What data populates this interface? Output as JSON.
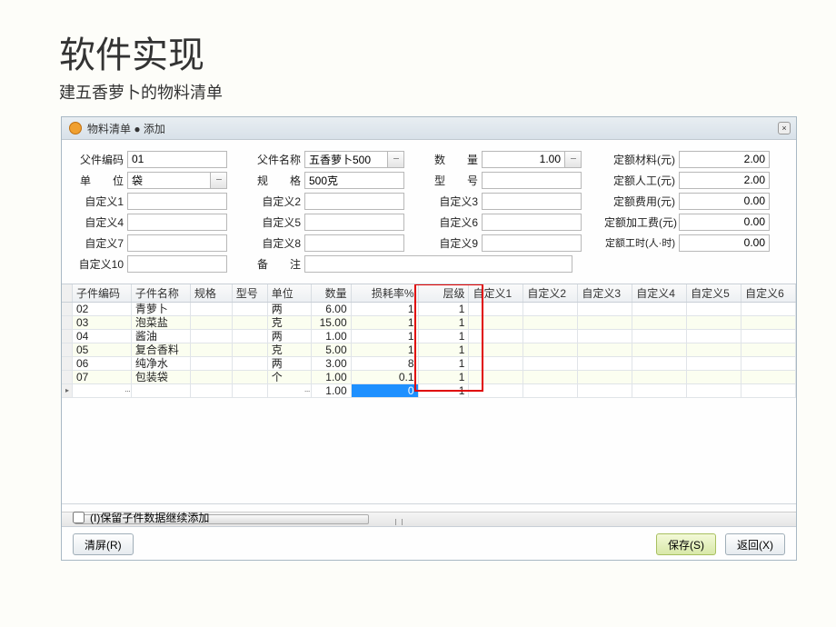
{
  "page": {
    "title": "软件实现",
    "subtitle": "建五香萝卜的物料清单"
  },
  "titlebar": {
    "text": "物料清单 ● 添加",
    "close": "×"
  },
  "form": {
    "parent_code_label": "父件编码",
    "parent_code": "01",
    "parent_name_label": "父件名称",
    "parent_name": "五香萝卜500",
    "qty_label": "数　　量",
    "qty": "1.00",
    "std_material_label": "定额材料(元)",
    "std_material": "2.00",
    "unit_label": "单　　位",
    "unit": "袋",
    "spec_label": "规　　格",
    "spec": "500克",
    "model_label": "型　　号",
    "model": "",
    "std_labor_label": "定额人工(元)",
    "std_labor": "2.00",
    "z1_label": "自定义1",
    "z1": "",
    "z2_label": "自定义2",
    "z2": "",
    "z3_label": "自定义3",
    "z3": "",
    "std_fee_label": "定额费用(元)",
    "std_fee": "0.00",
    "z4_label": "自定义4",
    "z4": "",
    "z5_label": "自定义5",
    "z5": "",
    "z6_label": "自定义6",
    "z6": "",
    "std_proc_label": "定额加工费(元)",
    "std_proc": "0.00",
    "z7_label": "自定义7",
    "z7": "",
    "z8_label": "自定义8",
    "z8": "",
    "z9_label": "自定义9",
    "z9": "",
    "std_time_label": "定额工时(人·时)",
    "std_time": "0.00",
    "z10_label": "自定义10",
    "z10": "",
    "remark_label": "备　　注",
    "remark": ""
  },
  "grid": {
    "headers": {
      "code": "子件编码",
      "name": "子件名称",
      "spec": "规格",
      "model": "型号",
      "unit": "单位",
      "qty": "数量",
      "loss": "损耗率%",
      "level": "层级",
      "z1": "自定义1",
      "z2": "自定义2",
      "z3": "自定义3",
      "z4": "自定义4",
      "z5": "自定义5",
      "z6": "自定义6"
    },
    "rows": [
      {
        "code": "02",
        "name": "青萝卜",
        "spec": "",
        "model": "",
        "unit": "两",
        "qty": "6.00",
        "loss": "1",
        "level": "1"
      },
      {
        "code": "03",
        "name": "泡菜盐",
        "spec": "",
        "model": "",
        "unit": "克",
        "qty": "15.00",
        "loss": "1",
        "level": "1"
      },
      {
        "code": "04",
        "name": "酱油",
        "spec": "",
        "model": "",
        "unit": "两",
        "qty": "1.00",
        "loss": "1",
        "level": "1"
      },
      {
        "code": "05",
        "name": "复合香料",
        "spec": "",
        "model": "",
        "unit": "克",
        "qty": "5.00",
        "loss": "1",
        "level": "1"
      },
      {
        "code": "06",
        "name": "纯净水",
        "spec": "",
        "model": "",
        "unit": "两",
        "qty": "3.00",
        "loss": "8",
        "level": "1"
      },
      {
        "code": "07",
        "name": "包装袋",
        "spec": "",
        "model": "",
        "unit": "个",
        "qty": "1.00",
        "loss": "0.1",
        "level": "1"
      }
    ],
    "newrow": {
      "qty": "1.00",
      "loss": "0",
      "level": "1"
    }
  },
  "footer": {
    "keep_children_label": "(I)保留子件数据继续添加",
    "clear_btn": "清屏(R)",
    "save_btn": "保存(S)",
    "back_btn": "返回(X)"
  }
}
